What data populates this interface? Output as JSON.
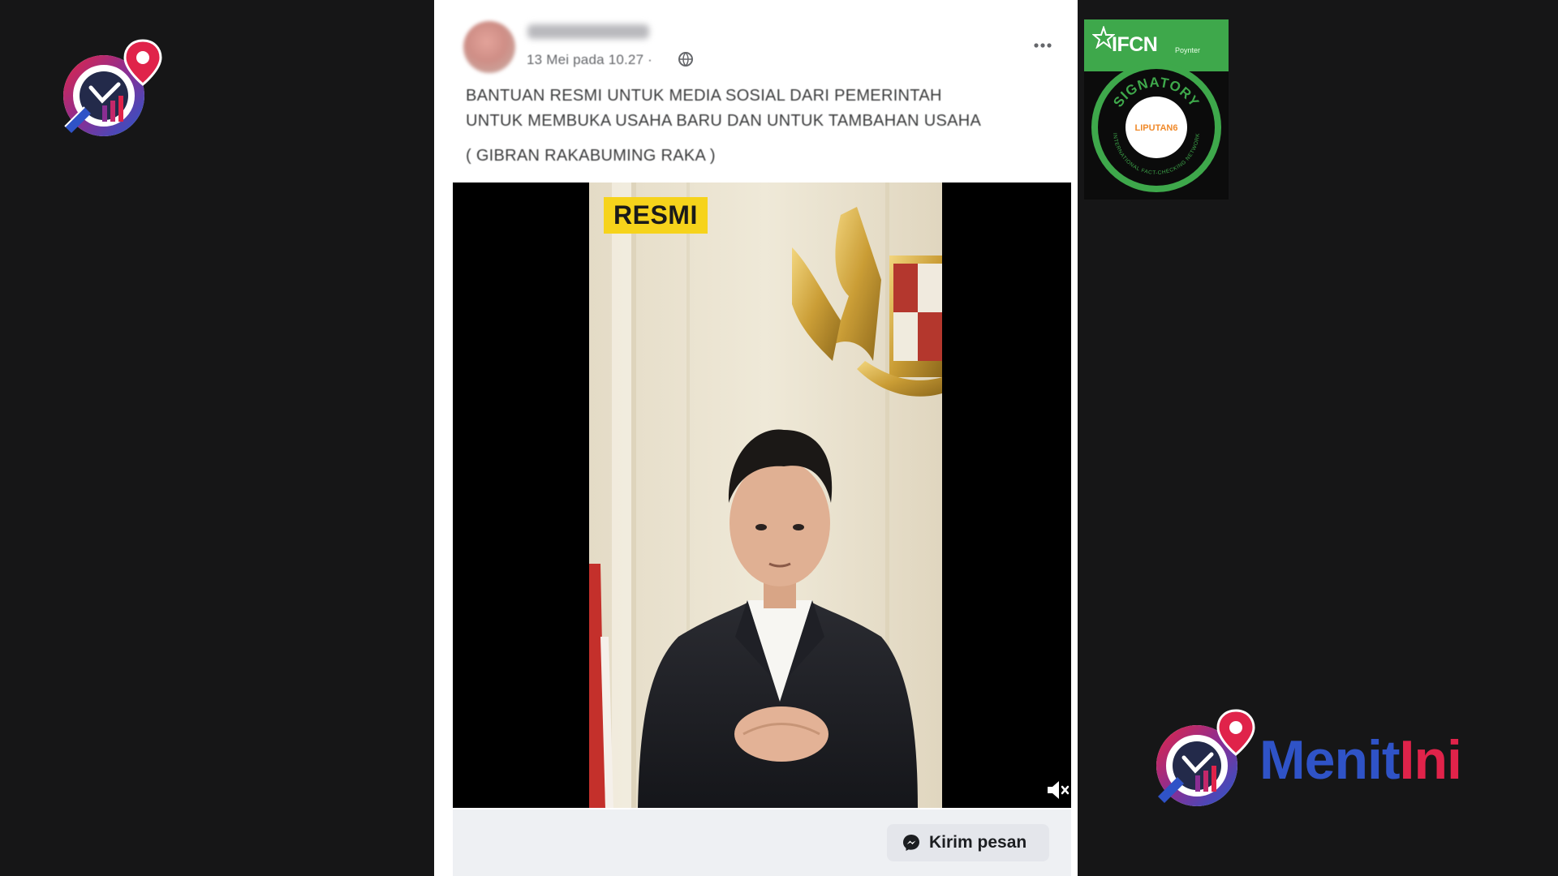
{
  "post": {
    "author_name": "",
    "timestamp": "13 Mei pada 10.27 ·",
    "text_lines": [
      "BANTUAN RESMI UNTUK MEDIA SOSIAL DARI PEMERINTAH",
      "UNTUK MEMBUKA USAHA BARU DAN UNTUK TAMBAHAN USAHA"
    ],
    "author_tag": "( GIBRAN RAKABUMING RAKA )",
    "video_badge": "RESMI",
    "message_button_label": "Kirim pesan",
    "icons": {
      "privacy": "globe-icon",
      "menu": "more-options-icon",
      "sound": "mute-icon",
      "message": "messenger-icon"
    }
  },
  "ifcn_badge": {
    "title": "IFCN",
    "subtitle": "Poynter",
    "ring_text": "SIGNATORY",
    "ring_subtext": "INTERNATIONAL FACT-CHECKING NETWORK",
    "center_text": "LIPUTAN6"
  },
  "brand": {
    "name_part1": "Menit",
    "name_part2": "Ini"
  },
  "colors": {
    "background": "#161617",
    "badge_yellow": "#f6d31b",
    "ifcn_green": "#3ea84b",
    "brand_blue": "#2f53c7",
    "brand_red": "#e0234a"
  }
}
